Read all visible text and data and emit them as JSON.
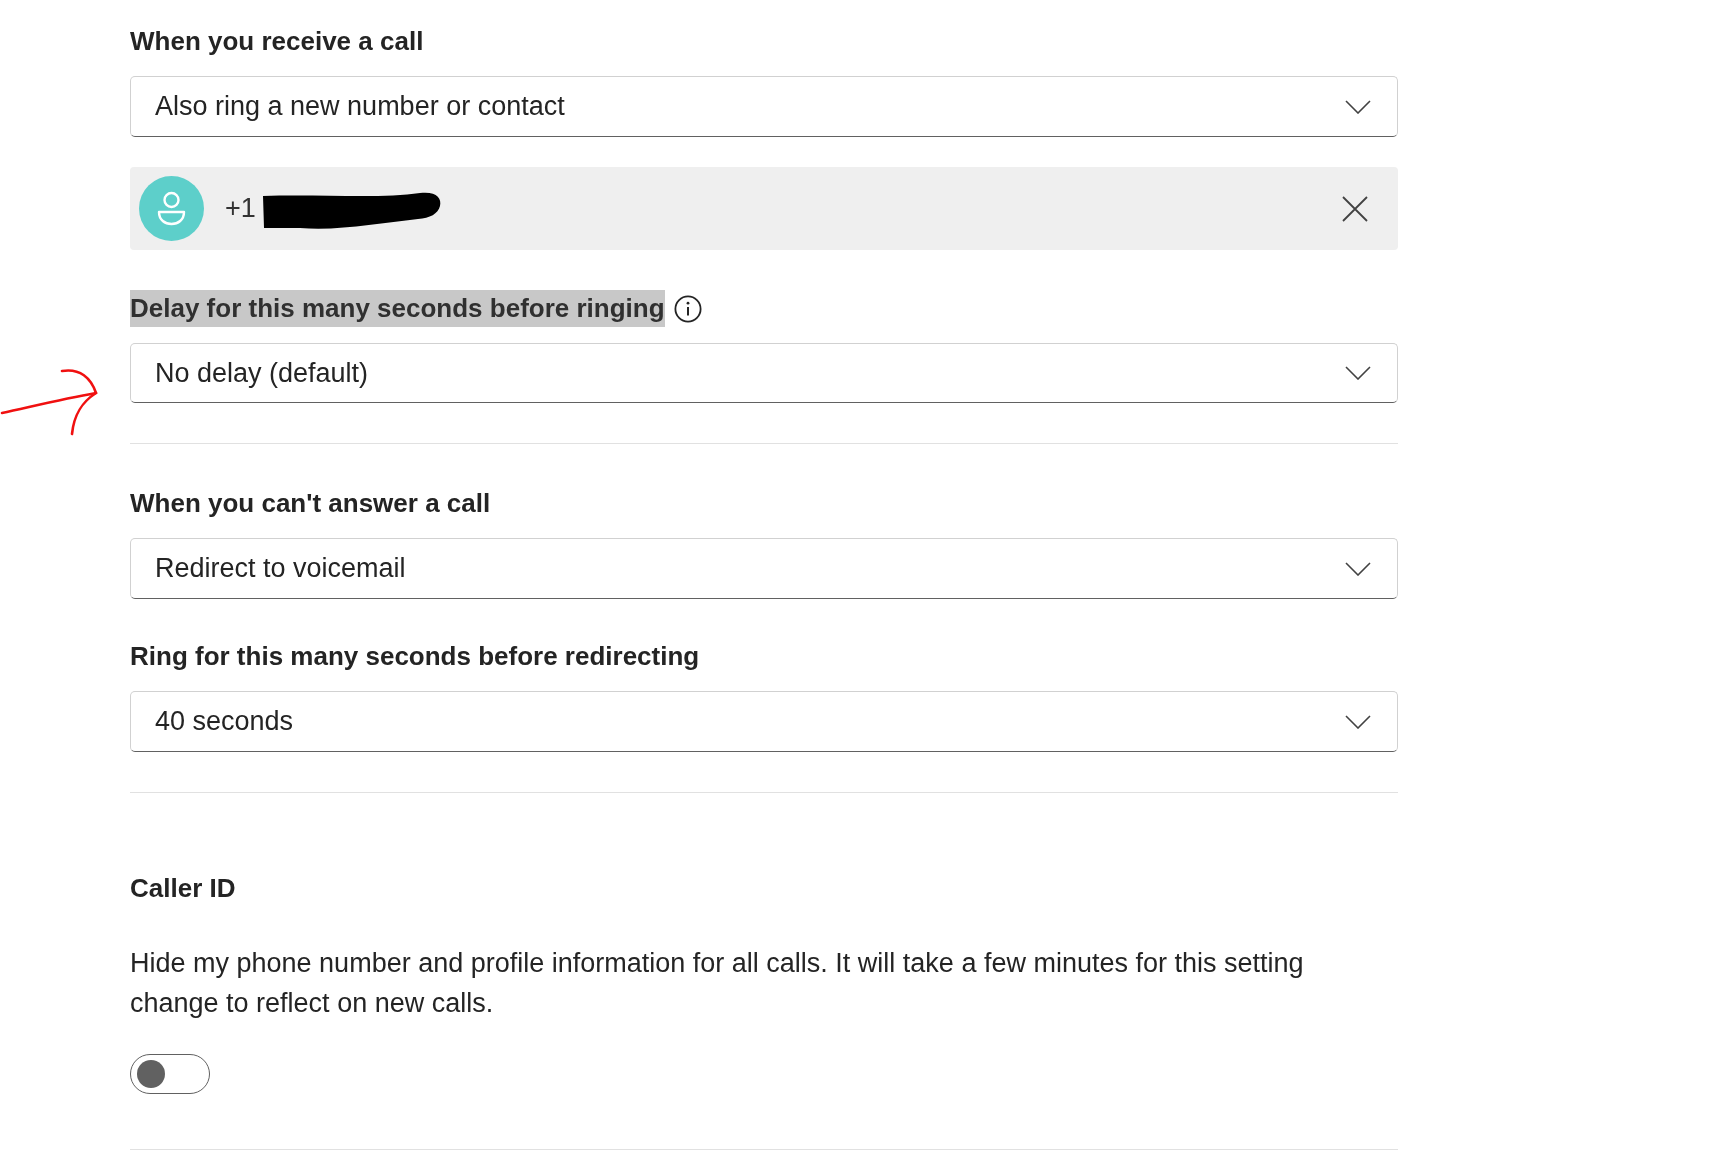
{
  "receive_call": {
    "heading": "When you receive a call",
    "dropdown": {
      "value": "Also ring a new number or contact"
    },
    "contact": {
      "number": "+1"
    },
    "delay": {
      "label": "Delay for this many seconds before ringing",
      "highlighted": true,
      "dropdown": {
        "value": "No delay (default)"
      }
    }
  },
  "unanswered_call": {
    "heading": "When you can't answer a call",
    "dropdown": {
      "value": "Redirect to voicemail"
    },
    "ring_label": "Ring for this many seconds before redirecting",
    "ring_dropdown": {
      "value": "40 seconds"
    }
  },
  "caller_id": {
    "heading": "Caller ID",
    "description": "Hide my phone number and profile information for all calls. It will take a few minutes for this setting change to reflect on new calls.",
    "toggle": {
      "on": false
    }
  }
}
